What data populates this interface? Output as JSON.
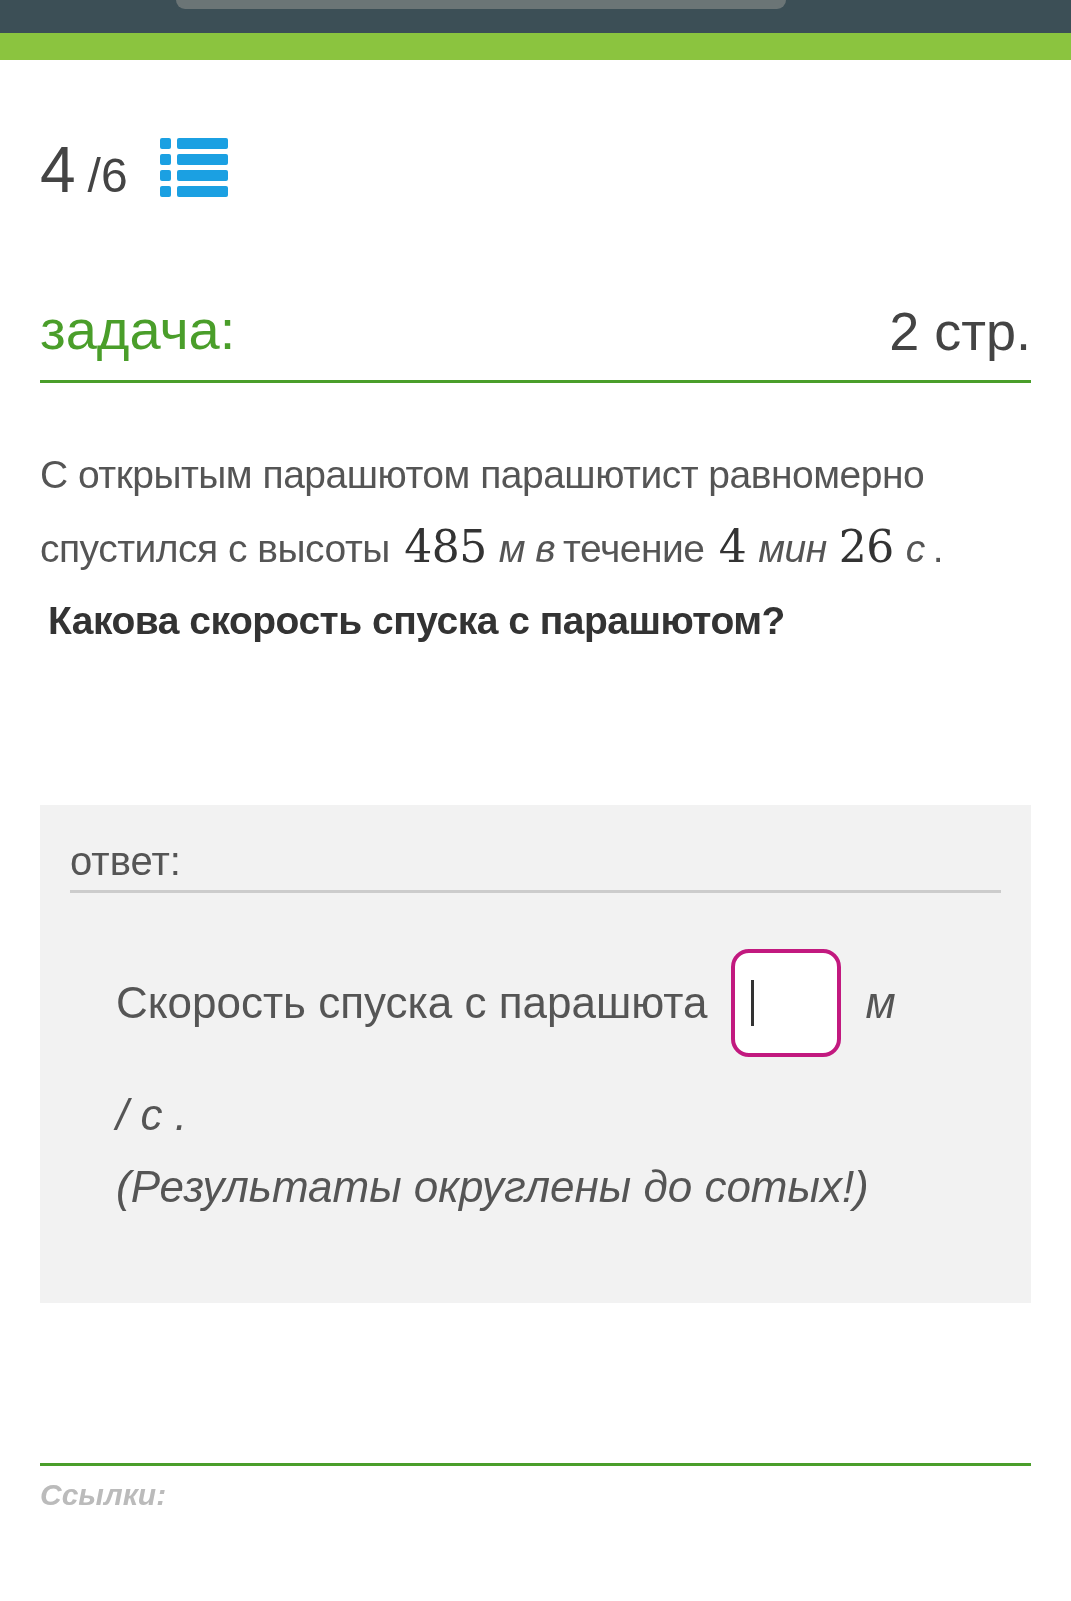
{
  "progress": {
    "current": "4",
    "total": "/6"
  },
  "task": {
    "label": "задача:",
    "points": "2 стр."
  },
  "problem": [
    {
      "kind": "text",
      "text": "С открытым парашютом парашютист равномерно спустился с высоты"
    },
    {
      "kind": "number",
      "text": "485"
    },
    {
      "kind": "unit",
      "text": "м в"
    },
    {
      "kind": "text",
      "text": "течение"
    },
    {
      "kind": "number",
      "text": "4"
    },
    {
      "kind": "unit",
      "text": "мин"
    },
    {
      "kind": "number",
      "text": "26"
    },
    {
      "kind": "unit",
      "text": "с"
    },
    {
      "kind": "text",
      "text": "."
    },
    {
      "kind": "question",
      "text": "Какова скорость спуска с парашютом?"
    }
  ],
  "answer": {
    "label": "ответ:",
    "prompt": "Скорость спуска с парашюта",
    "unit_start": "м",
    "unit_end": "/ с .",
    "note": "(Результаты округлены до сотых!)"
  },
  "links_label": "Ссылки:"
}
